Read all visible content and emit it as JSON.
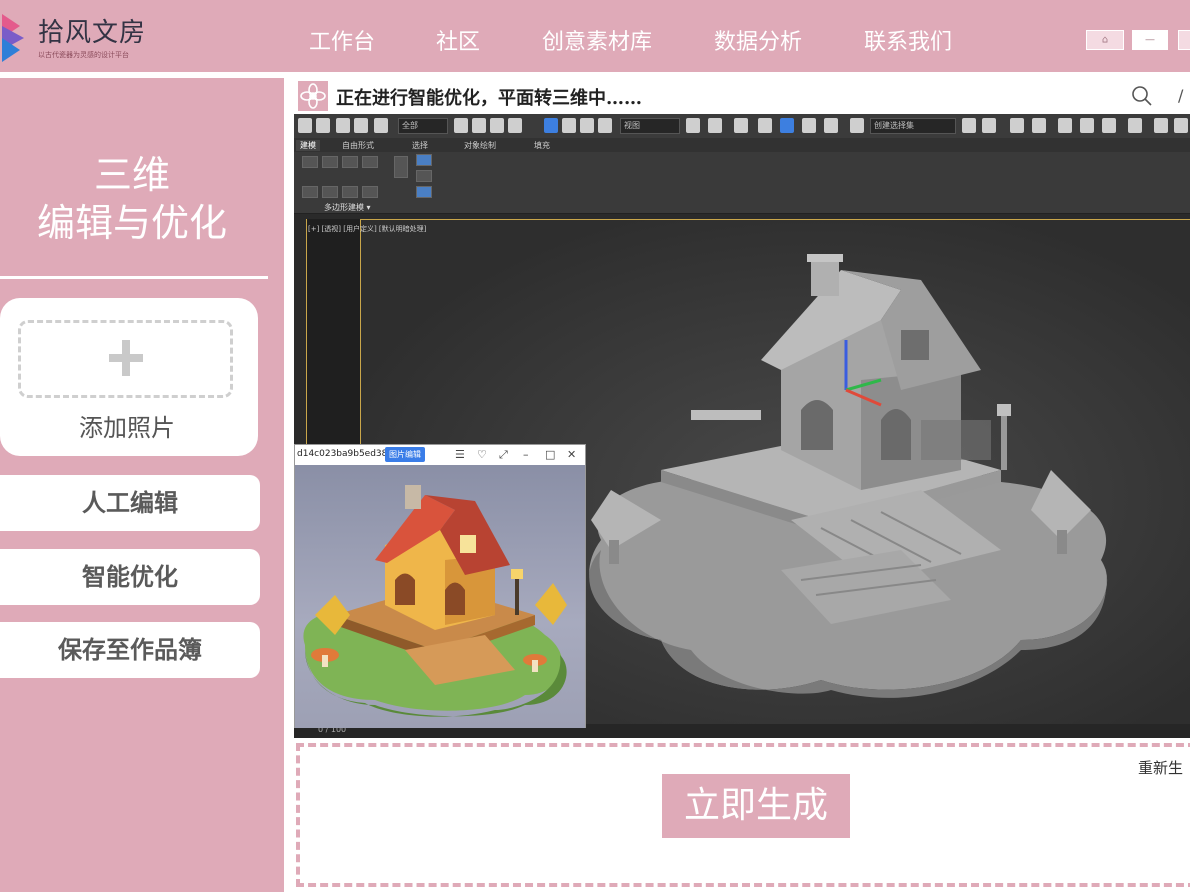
{
  "brand": {
    "name": "拾风文房",
    "tagline": "以古代瓷器为灵感的设计平台",
    "accent_color": "#dfaab8"
  },
  "nav": {
    "items": [
      "工作台",
      "社区",
      "创意素材库",
      "数据分析",
      "联系我们"
    ]
  },
  "sidebar": {
    "title_line1": "三维",
    "title_line2": "编辑与优化",
    "upload_label": "添加照片",
    "buttons": [
      "人工编辑",
      "智能优化",
      "保存至作品簿"
    ]
  },
  "status": {
    "icon": "flower-icon",
    "text": "正在进行智能优化，平面转三维中……"
  },
  "editor": {
    "toolbar_dropdowns": [
      "全部",
      "视图",
      "创建选择集"
    ],
    "ribbon_tabs": [
      "建模",
      "自由形式",
      "选择",
      "对象绘制",
      "填充"
    ],
    "ribbon_group": "多边形建模 ▾",
    "viewport_label": "[+] [透视] [用户定义] [默认明暗处理]",
    "timeline": "0 / 100"
  },
  "image_window": {
    "title": "d14c023ba9b5ed382",
    "edit_button": "图片编辑",
    "controls": [
      "☰",
      "♡",
      "⤢",
      "–",
      "□",
      "✕"
    ]
  },
  "generate": {
    "button": "立即生成",
    "regenerate": "重新生"
  }
}
